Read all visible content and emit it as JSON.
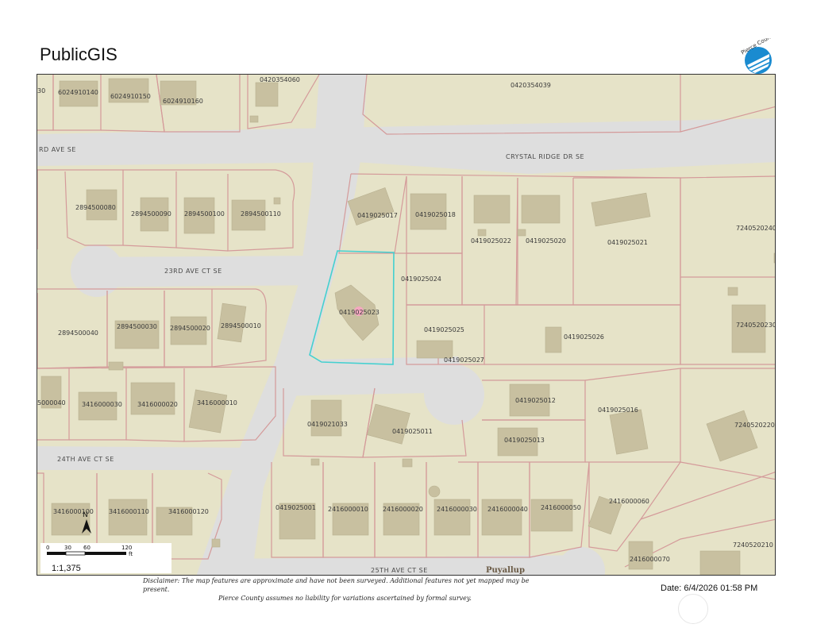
{
  "header": {
    "title": "PublicGIS",
    "logo_text": "Pierce County"
  },
  "map": {
    "colors": {
      "background": "#e6e3c8",
      "road": "#dedede",
      "parcel_line": "#d49a9a",
      "building": "#c8c0a0",
      "selected_outline": "#44d0d0",
      "selected_marker": "#f4a8c0"
    },
    "streets": {
      "rd_ave": "RD AVE SE",
      "crystal_ridge": "CRYSTAL RIDGE DR SE",
      "ct_23rd": "23RD AVE CT SE",
      "ct_24th": "24TH AVE CT SE",
      "ave_25th": "25TH AVE CT SE"
    },
    "city_label": "Puyallup",
    "parcels": {
      "p1": "30",
      "p2": "6024910140",
      "p3": "6024910150",
      "p4": "6024910160",
      "p5": "0420354060",
      "p6": "0420354039",
      "p7": "2894500080",
      "p8": "2894500090",
      "p9": "2894500100",
      "p10": "2894500110",
      "p11": "0419025017",
      "p12": "0419025018",
      "p13": "0419025022",
      "p14": "0419025020",
      "p15": "0419025021",
      "p16": "7240520240",
      "p17": "0419025024",
      "p18": "0419025023",
      "p19": "2894500040",
      "p20": "2894500030",
      "p21": "2894500020",
      "p22": "2894500010",
      "p23": "0419025025",
      "p24": "0419025026",
      "p25": "7240520230",
      "p26": "0419025027",
      "p27": "5000040",
      "p28": "3416000030",
      "p29": "3416000020",
      "p30": "3416000010",
      "p31": "0419025012",
      "p32": "0419025016",
      "p33": "0419021033",
      "p34": "0419025011",
      "p35": "0419025013",
      "p36": "7240520220",
      "p37": "3416000100",
      "p38": "3416000110",
      "p39": "3416000120",
      "p40": "0419025001",
      "p41": "2416000010",
      "p42": "2416000020",
      "p43": "2416000030",
      "p44": "2416000040",
      "p45": "2416000050",
      "p46": "2416000060",
      "p47": "7240520210",
      "p48": "2416000070"
    },
    "north_label": "N",
    "scale": {
      "t0": "0",
      "t1": "30",
      "t2": "60",
      "t3": "120",
      "unit": "ft",
      "ratio": "1:1,375"
    }
  },
  "footer": {
    "disclaimer_line1": "Disclaimer: The map features are approximate and have not been surveyed. Additional features not yet mapped may be present.",
    "disclaimer_line2": "Pierce County assumes no liability for variations ascertained by formal survey.",
    "date": "Date: 6/4/2026  01:58 PM"
  }
}
